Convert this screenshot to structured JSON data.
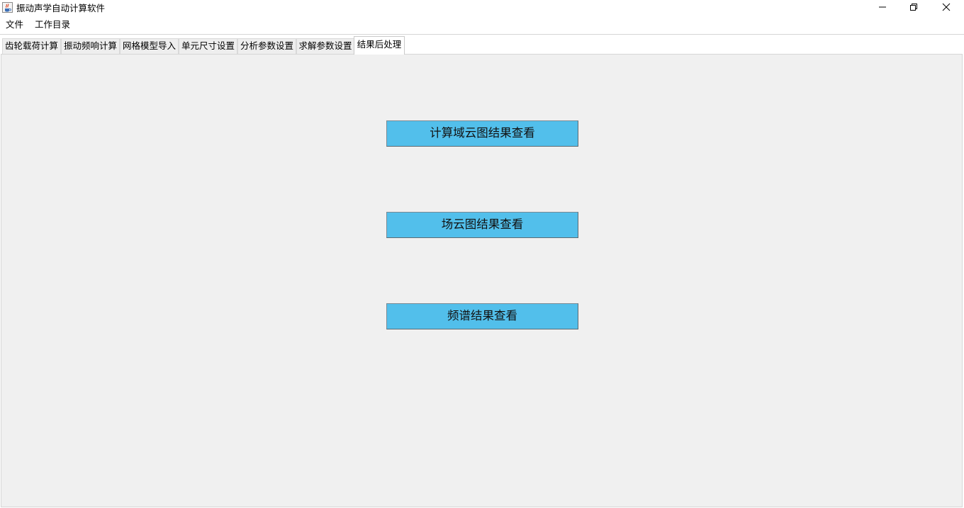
{
  "window": {
    "title": "振动声学自动计算软件"
  },
  "menu": {
    "items": [
      {
        "label": "文件"
      },
      {
        "label": "工作目录"
      }
    ]
  },
  "tabs": [
    {
      "label": "齿轮载荷计算",
      "active": false
    },
    {
      "label": "振动频响计算",
      "active": false
    },
    {
      "label": "网格模型导入",
      "active": false
    },
    {
      "label": "单元尺寸设置",
      "active": false
    },
    {
      "label": "分析参数设置",
      "active": false
    },
    {
      "label": "求解参数设置",
      "active": false
    },
    {
      "label": "结果后处理",
      "active": true
    }
  ],
  "content": {
    "buttons": [
      {
        "label": "计算域云图结果查看"
      },
      {
        "label": "场云图结果查看"
      },
      {
        "label": "频谱结果查看"
      }
    ]
  },
  "colors": {
    "button_fill": "#52bfeb",
    "panel_background": "#f0f0f0",
    "window_background": "#ffffff"
  },
  "icons": {
    "app": "java-coffee-cup-icon",
    "minimize": "minimize-icon",
    "maximize": "restore-icon",
    "close": "close-icon"
  }
}
